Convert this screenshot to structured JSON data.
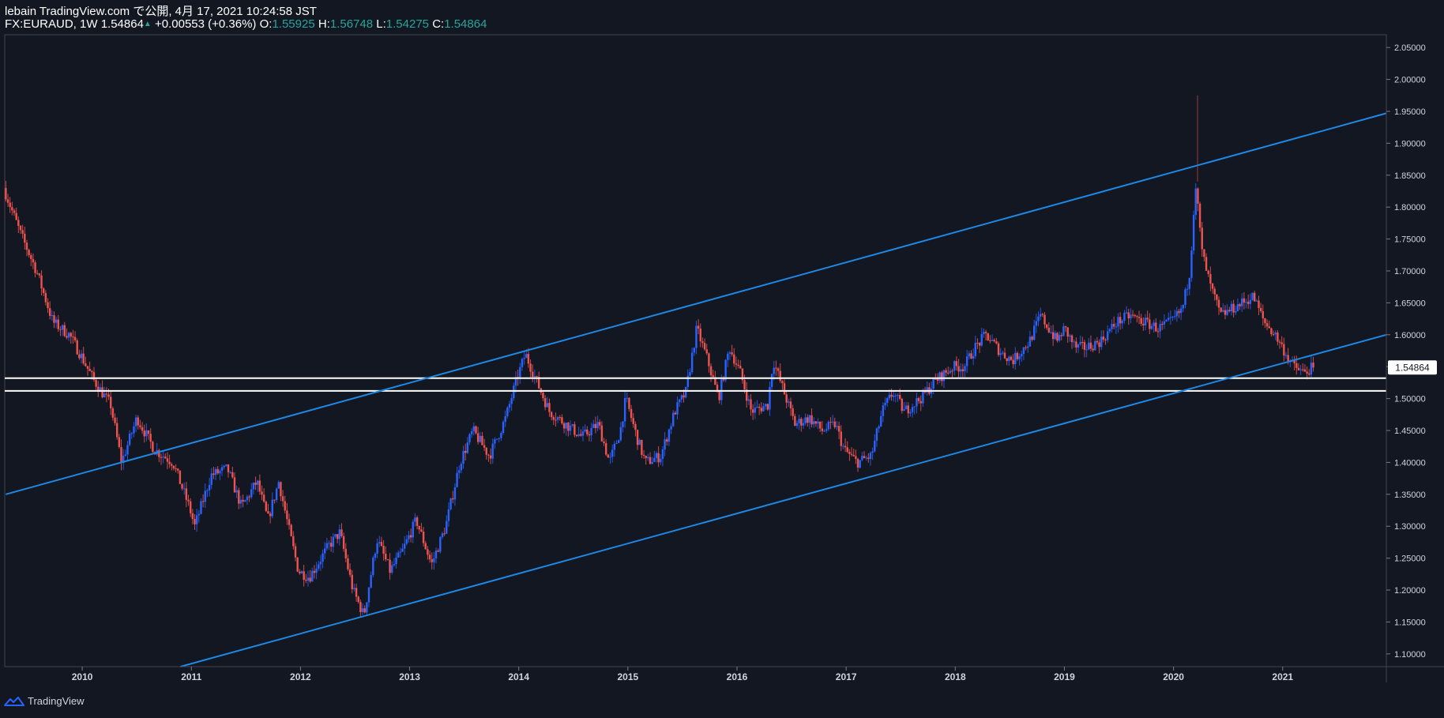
{
  "header": {
    "published": "lebain TradingView.com で公開, 4月 17, 2021 10:24:58 JST",
    "symbol": "FX:EURAUD, 1W",
    "last": "1.54864",
    "change": "+0.00553 (+0.36%)",
    "open_label": "O:",
    "open": "1.55925",
    "high_label": "H:",
    "high": "1.56748",
    "low_label": "L:",
    "low": "1.54275",
    "close_label": "C:",
    "close": "1.54864"
  },
  "footer": {
    "brand": "TradingView"
  },
  "colors": {
    "background": "#131722",
    "up_candle": "#2962ff",
    "down_candle": "#ef5350",
    "trendline": "#1e88e5",
    "price_label_bg": "#ffffff",
    "positive_text": "#26a69a"
  },
  "chart_data": {
    "type": "candlestick",
    "symbol": "FX:EURAUD",
    "interval": "1W",
    "x_axis": {
      "labels": [
        "2010",
        "2011",
        "2012",
        "2013",
        "2014",
        "2015",
        "2016",
        "2017",
        "2018",
        "2019",
        "2020",
        "2021"
      ],
      "range": [
        2009.29,
        2021.95
      ]
    },
    "y_axis": {
      "ticks": [
        "2.05000",
        "2.00000",
        "1.95000",
        "1.90000",
        "1.85000",
        "1.80000",
        "1.75000",
        "1.70000",
        "1.65000",
        "1.60000",
        "1.55000",
        "1.50000",
        "1.45000",
        "1.40000",
        "1.35000",
        "1.30000",
        "1.25000",
        "1.20000",
        "1.15000",
        "1.10000"
      ],
      "range": [
        1.08,
        2.07
      ]
    },
    "last_price_label": "1.54864",
    "last_price": 1.54864,
    "series_path": [
      [
        2009.3,
        1.83
      ],
      [
        2009.45,
        1.76
      ],
      [
        2009.6,
        1.7
      ],
      [
        2009.75,
        1.62
      ],
      [
        2009.9,
        1.6
      ],
      [
        2010.0,
        1.57
      ],
      [
        2010.12,
        1.53
      ],
      [
        2010.28,
        1.49
      ],
      [
        2010.38,
        1.4
      ],
      [
        2010.52,
        1.47
      ],
      [
        2010.68,
        1.42
      ],
      [
        2010.85,
        1.4
      ],
      [
        2011.0,
        1.33
      ],
      [
        2011.05,
        1.3
      ],
      [
        2011.2,
        1.38
      ],
      [
        2011.35,
        1.39
      ],
      [
        2011.48,
        1.33
      ],
      [
        2011.62,
        1.37
      ],
      [
        2011.72,
        1.31
      ],
      [
        2011.82,
        1.37
      ],
      [
        2011.92,
        1.29
      ],
      [
        2012.0,
        1.23
      ],
      [
        2012.1,
        1.22
      ],
      [
        2012.28,
        1.27
      ],
      [
        2012.38,
        1.29
      ],
      [
        2012.5,
        1.2
      ],
      [
        2012.6,
        1.16
      ],
      [
        2012.72,
        1.28
      ],
      [
        2012.84,
        1.23
      ],
      [
        2012.95,
        1.26
      ],
      [
        2013.08,
        1.31
      ],
      [
        2013.22,
        1.24
      ],
      [
        2013.35,
        1.3
      ],
      [
        2013.48,
        1.4
      ],
      [
        2013.6,
        1.45
      ],
      [
        2013.75,
        1.41
      ],
      [
        2013.9,
        1.47
      ],
      [
        2014.0,
        1.53
      ],
      [
        2014.08,
        1.57
      ],
      [
        2014.2,
        1.52
      ],
      [
        2014.3,
        1.48
      ],
      [
        2014.45,
        1.46
      ],
      [
        2014.6,
        1.44
      ],
      [
        2014.75,
        1.46
      ],
      [
        2014.85,
        1.4
      ],
      [
        2014.95,
        1.45
      ],
      [
        2015.0,
        1.5
      ],
      [
        2015.1,
        1.44
      ],
      [
        2015.18,
        1.4
      ],
      [
        2015.32,
        1.41
      ],
      [
        2015.45,
        1.48
      ],
      [
        2015.55,
        1.51
      ],
      [
        2015.65,
        1.61
      ],
      [
        2015.75,
        1.56
      ],
      [
        2015.85,
        1.5
      ],
      [
        2015.95,
        1.58
      ],
      [
        2016.05,
        1.54
      ],
      [
        2016.15,
        1.48
      ],
      [
        2016.3,
        1.49
      ],
      [
        2016.35,
        1.56
      ],
      [
        2016.45,
        1.51
      ],
      [
        2016.55,
        1.46
      ],
      [
        2016.68,
        1.47
      ],
      [
        2016.8,
        1.45
      ],
      [
        2016.92,
        1.46
      ],
      [
        2017.0,
        1.42
      ],
      [
        2017.12,
        1.4
      ],
      [
        2017.25,
        1.41
      ],
      [
        2017.35,
        1.48
      ],
      [
        2017.45,
        1.51
      ],
      [
        2017.55,
        1.48
      ],
      [
        2017.7,
        1.5
      ],
      [
        2017.85,
        1.53
      ],
      [
        2018.0,
        1.55
      ],
      [
        2018.1,
        1.55
      ],
      [
        2018.2,
        1.58
      ],
      [
        2018.3,
        1.6
      ],
      [
        2018.45,
        1.57
      ],
      [
        2018.55,
        1.56
      ],
      [
        2018.7,
        1.59
      ],
      [
        2018.8,
        1.63
      ],
      [
        2018.95,
        1.59
      ],
      [
        2019.02,
        1.61
      ],
      [
        2019.12,
        1.58
      ],
      [
        2019.22,
        1.58
      ],
      [
        2019.35,
        1.59
      ],
      [
        2019.5,
        1.62
      ],
      [
        2019.62,
        1.63
      ],
      [
        2019.75,
        1.62
      ],
      [
        2019.88,
        1.61
      ],
      [
        2020.0,
        1.62
      ],
      [
        2020.1,
        1.64
      ],
      [
        2020.17,
        1.7
      ],
      [
        2020.22,
        1.84
      ],
      [
        2020.28,
        1.73
      ],
      [
        2020.35,
        1.68
      ],
      [
        2020.45,
        1.63
      ],
      [
        2020.55,
        1.64
      ],
      [
        2020.65,
        1.65
      ],
      [
        2020.75,
        1.66
      ],
      [
        2020.85,
        1.62
      ],
      [
        2020.95,
        1.6
      ],
      [
        2021.05,
        1.57
      ],
      [
        2021.12,
        1.55
      ],
      [
        2021.22,
        1.54
      ],
      [
        2021.29,
        1.5486
      ]
    ],
    "trendlines": [
      {
        "name": "channel-upper",
        "points": [
          [
            2009.3,
            1.35
          ],
          [
            2021.95,
            1.947
          ]
        ]
      },
      {
        "name": "channel-lower",
        "points": [
          [
            2010.9,
            1.08
          ],
          [
            2021.95,
            1.6
          ]
        ]
      }
    ],
    "horizontal_lines": [
      1.532,
      1.512
    ]
  }
}
